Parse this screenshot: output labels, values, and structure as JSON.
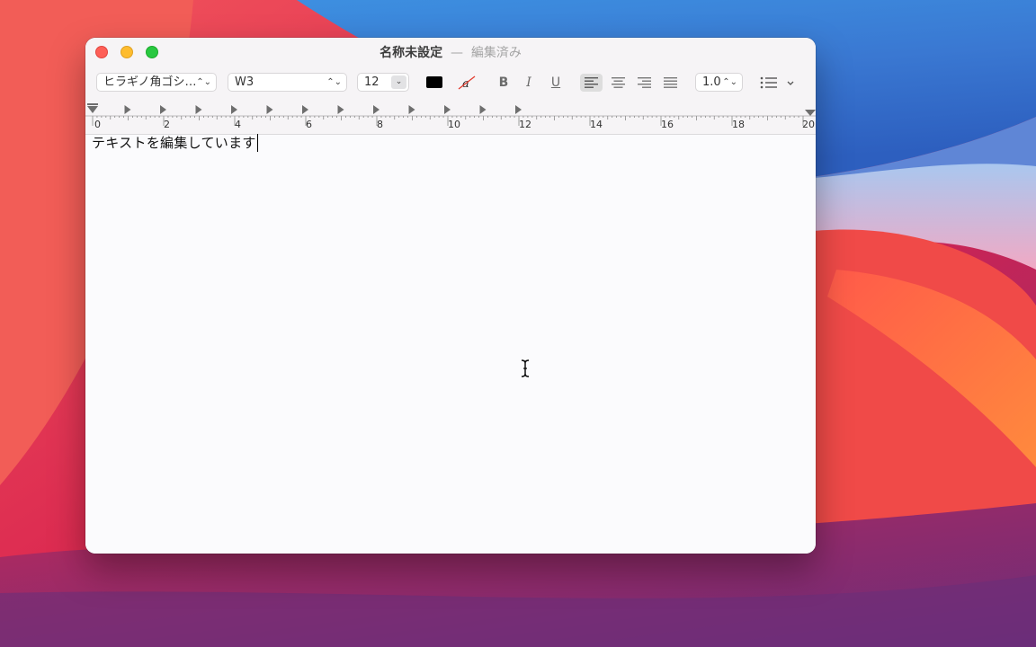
{
  "window": {
    "title": "名称未設定",
    "separator": "—",
    "status": "編集済み"
  },
  "toolbar": {
    "font_family": "ヒラギノ角ゴシ…",
    "font_style": "W3",
    "font_size": "12",
    "text_color": "#000000",
    "bold_label": "B",
    "italic_label": "I",
    "underline_label": "U",
    "line_spacing": "1.0",
    "alignment_selected": "left"
  },
  "ruler": {
    "labels": [
      "0",
      "2",
      "4",
      "6",
      "8",
      "10",
      "12",
      "14",
      "16",
      "18",
      "20"
    ]
  },
  "document": {
    "text": "テキストを編集しています"
  },
  "icons": [
    "close-button",
    "minimize-button",
    "zoom-button",
    "updown-icon",
    "stepper-down-icon",
    "no-color-icon",
    "align-left-icon",
    "align-center-icon",
    "align-right-icon",
    "align-justify-icon",
    "list-icon",
    "chevron-down-icon",
    "tab-stop-icon",
    "indent-marker-icon",
    "text-cursor-icon"
  ]
}
